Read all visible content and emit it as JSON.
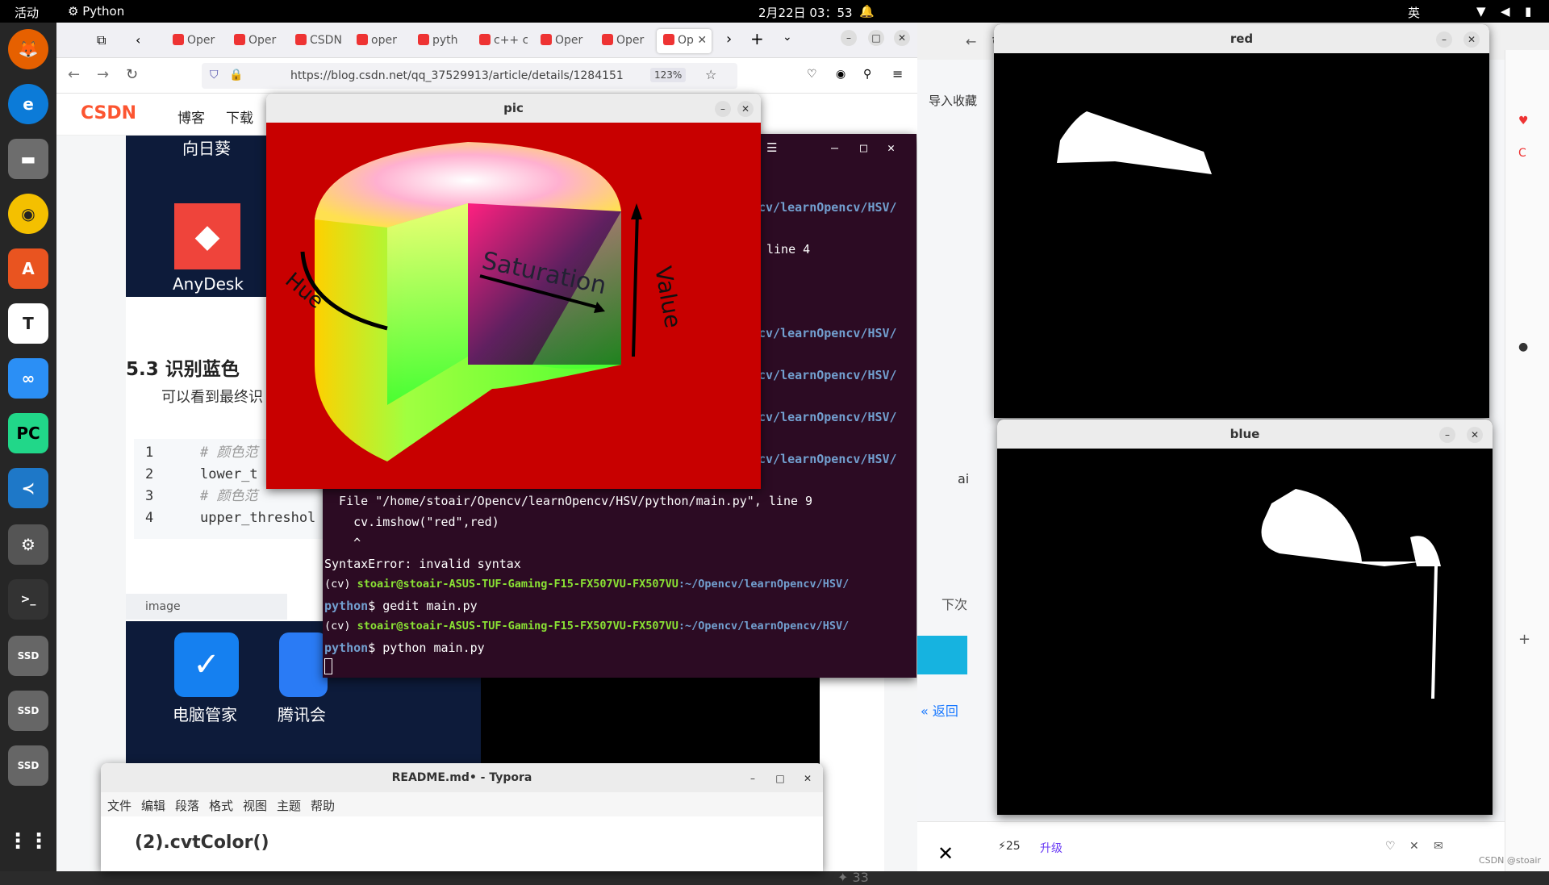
{
  "topbar": {
    "activities": "活动",
    "app": "Python",
    "datetime": "2月22日 03：53",
    "ime": "英"
  },
  "browser": {
    "tabs": [
      "Oper",
      "Oper",
      "CSDN",
      "oper",
      "pyth",
      "c++ c",
      "Oper",
      "Oper",
      "Op"
    ],
    "url": "https://blog.csdn.net/qq_37529913/article/details/1284151",
    "zoom": "123%",
    "nav_links": [
      "博客",
      "下载"
    ],
    "logo": "CSDN"
  },
  "article": {
    "heading": "5.3 识别蓝色",
    "para": "可以看到最终识",
    "anydesk": "AnyDesk",
    "sunflower": "向日葵",
    "image_label": "image",
    "pc_manager": "电脑管家",
    "tencent": "腾讯会",
    "code_lines": [
      {
        "n": "1",
        "t": "# 颜色范"
      },
      {
        "n": "2",
        "t": "lower_t"
      },
      {
        "n": "3",
        "t": "# 颜色范"
      },
      {
        "n": "4",
        "t": "upper_threshol"
      }
    ],
    "likes": "33"
  },
  "terminal": {
    "lines": [
      "cv/learnOpencv/HSV/",
      "line 4",
      "cv/learnOpencv/HSV/",
      "cv/learnOpencv/HSV/",
      "cv/learnOpencv/HSV/",
      "cv/learnOpencv/HSV/"
    ],
    "err_file": "  File \"/home/stoair/Opencv/learnOpencv/HSV/python/main.py\", line 9",
    "err_code": "    cv.imshow(\"red\",red)",
    "err_caret": "    ^",
    "err_msg": "SyntaxError: invalid syntax",
    "env": "(cv)",
    "user": "stoair@stoair-ASUS-TUF-Gaming-F15-FX507VU-FX507VU",
    "path": ":~/Opencv/learnOpencv/HSV/",
    "path2": "python",
    "cmd1": "$ gedit main.py",
    "cmd2": "$ python main.py"
  },
  "pic": {
    "title": "pic",
    "hue": "Hue",
    "saturation": "Saturation",
    "value": "Value"
  },
  "red_win": {
    "title": "red"
  },
  "blue_win": {
    "title": "blue"
  },
  "typora": {
    "title": "README.md• - Typora",
    "menu": [
      "文件",
      "编辑",
      "段落",
      "格式",
      "视图",
      "主题",
      "帮助"
    ],
    "heading": "(2).cvtColor()"
  },
  "right_panel": {
    "import": "导入收藏",
    "back": "« 返回",
    "next_time": "下次",
    "count": "25",
    "upgrade": "升级",
    "watermark": "CSDN @stoair",
    "ai": "ai"
  },
  "colors": {
    "terminal_bg": "#2c0b23",
    "csdn_red": "#fc5531",
    "pic_bg": "#c80000"
  }
}
